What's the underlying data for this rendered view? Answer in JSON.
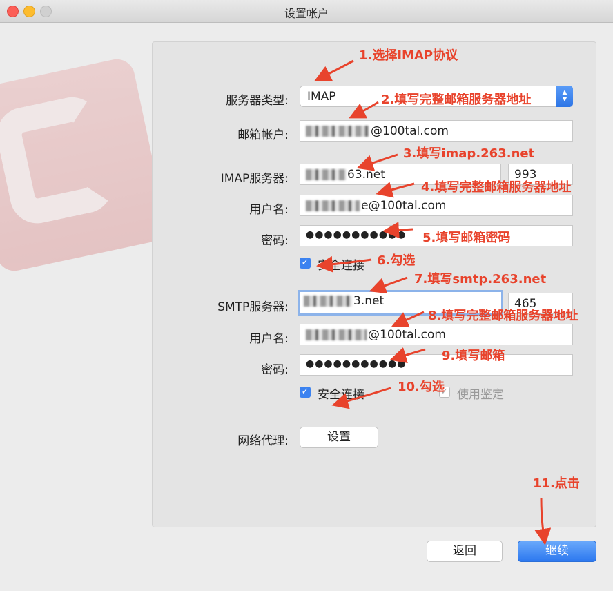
{
  "window": {
    "title": "设置帐户"
  },
  "form": {
    "server_type": {
      "label": "服务器类型:",
      "value": "IMAP"
    },
    "account": {
      "label": "邮箱帐户:",
      "value_suffix": "@100tal.com"
    },
    "imap_server": {
      "label": "IMAP服务器:",
      "value_suffix": "63.net",
      "port": "993"
    },
    "imap_user": {
      "label": "用户名:",
      "value_suffix": "e@100tal.com"
    },
    "imap_password": {
      "label": "密码:",
      "value": "●●●●●●●●●●●"
    },
    "imap_secure": {
      "label": "安全连接",
      "checked": true
    },
    "smtp_server": {
      "label": "SMTP服务器:",
      "value_suffix": "3.net",
      "port": "465"
    },
    "smtp_user": {
      "label": "用户名:",
      "value_suffix": "@100tal.com"
    },
    "smtp_password": {
      "label": "密码:",
      "value": "●●●●●●●●●●●"
    },
    "smtp_secure": {
      "label": "安全连接",
      "checked": true
    },
    "smtp_auth": {
      "label": "使用鉴定",
      "checked": true,
      "disabled": true
    },
    "proxy": {
      "label": "网络代理:",
      "button": "设置"
    }
  },
  "footer": {
    "back": "返回",
    "continue": "继续"
  },
  "annotations": [
    "1.选择IMAP协议",
    "2.填写完整邮箱服务器地址",
    "3.填写imap.263.net",
    "4.填写完整邮箱服务器地址",
    "5.填写邮箱密码",
    "6.勾选",
    "7.填写smtp.263.net",
    "8.填写完整邮箱服务器地址",
    "9.填写邮箱",
    "10.勾选",
    "11.点击"
  ],
  "colors": {
    "annotation": "#e8432c",
    "accent": "#3b82f0"
  },
  "icons": {
    "checkbox": "checkmark-icon",
    "select": "chevron-updown-icon"
  }
}
